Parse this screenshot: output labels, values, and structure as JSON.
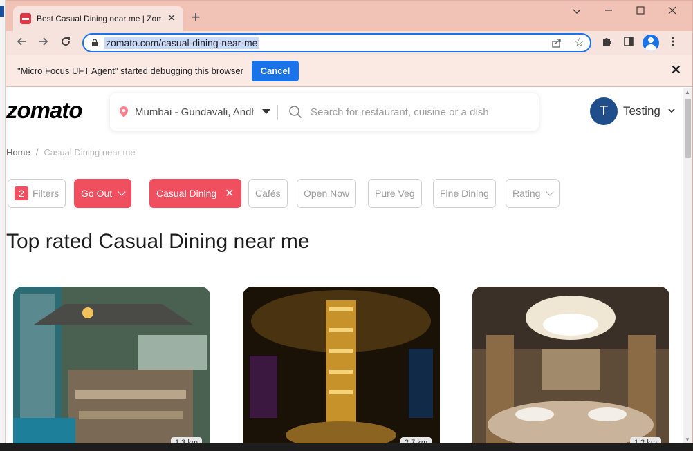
{
  "browser": {
    "tab_title": "Best Casual Dining near me | Zomato",
    "new_tab_symbol": "+",
    "url": "zomato.com/casual-dining-near-me"
  },
  "infobar": {
    "message": "\"Micro Focus UFT Agent\" started debugging this browser",
    "cancel_label": "Cancel"
  },
  "site": {
    "logo": "zomato",
    "location": "Mumbai - Gundavali, Andheri East",
    "search_placeholder": "Search for restaurant, cuisine or a dish",
    "user_initial": "T",
    "user_name": "Testing"
  },
  "breadcrumb": {
    "home": "Home",
    "separator": "/",
    "current": "Casual Dining near me"
  },
  "filters": {
    "count": "2",
    "filters_label": "Filters",
    "go_out": "Go Out",
    "casual_dining": "Casual Dining",
    "cafes": "Cafés",
    "open_now": "Open Now",
    "pure_veg": "Pure Veg",
    "fine_dining": "Fine Dining",
    "rating": "Rating"
  },
  "heading": "Top rated Casual Dining near me",
  "cards": [
    {
      "distance": "1.3 km"
    },
    {
      "distance": "2.7 km"
    },
    {
      "distance": "1.2 km"
    }
  ],
  "colors": {
    "brand": "#ef4f5f",
    "chrome_tab": "#f1c3b7",
    "accent_blue": "#1a73e8"
  }
}
